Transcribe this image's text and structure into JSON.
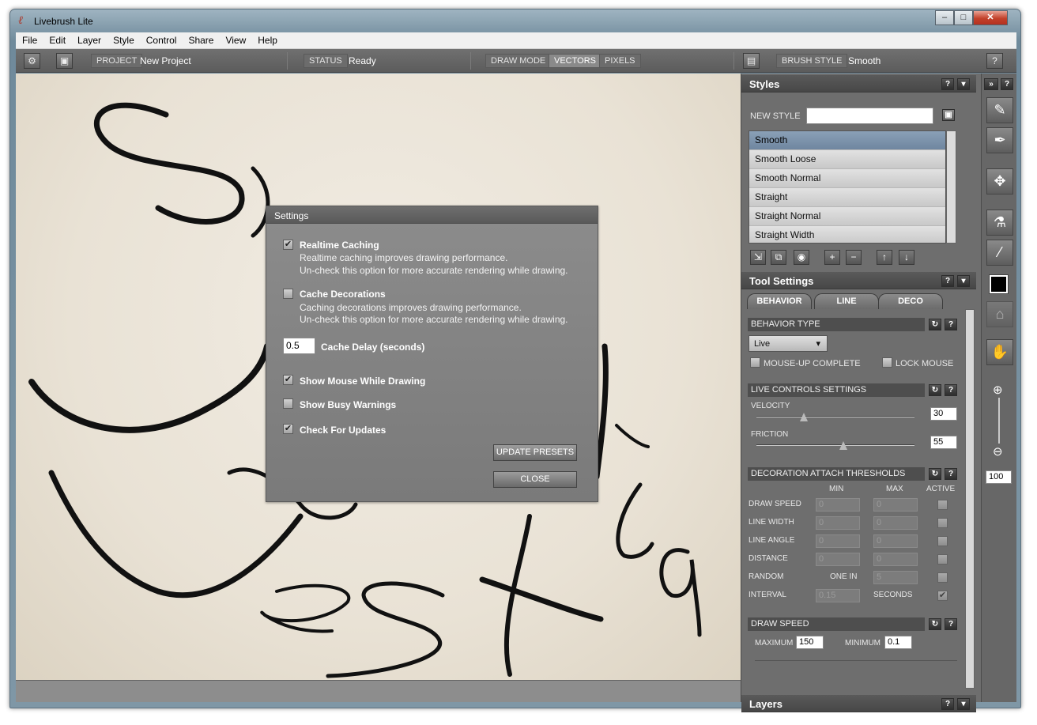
{
  "window": {
    "title": "Livebrush Lite",
    "minimize": "–",
    "maximize": "□",
    "close": "✕"
  },
  "menu": [
    "File",
    "Edit",
    "Layer",
    "Style",
    "Control",
    "Share",
    "View",
    "Help"
  ],
  "toolbar": {
    "project_label": "PROJECT",
    "project_value": "New Project",
    "status_label": "STATUS",
    "status_value": "Ready",
    "draw_mode_label": "DRAW MODE",
    "vectors": "VECTORS",
    "pixels": "PIXELS",
    "brush_style_label": "BRUSH STYLE",
    "brush_style_value": "Smooth",
    "help": "?"
  },
  "canvas_handwriting": "Softpedia",
  "settings_dialog": {
    "title": "Settings",
    "realtime_caching": {
      "label": "Realtime Caching",
      "checked": true,
      "desc1": "Realtime caching improves drawing performance.",
      "desc2": "Un-check this option for more accurate rendering while drawing."
    },
    "cache_decorations": {
      "label": "Cache Decorations",
      "checked": false,
      "desc1": "Caching decorations improves drawing performance.",
      "desc2": "Un-check this option for more accurate rendering while drawing."
    },
    "cache_delay_value": "0.5",
    "cache_delay_label": "Cache Delay (seconds)",
    "show_mouse": {
      "label": "Show Mouse While Drawing",
      "checked": true
    },
    "show_busy": {
      "label": "Show Busy Warnings",
      "checked": false
    },
    "check_updates": {
      "label": "Check For Updates",
      "checked": true
    },
    "update_presets": "UPDATE PRESETS",
    "close": "CLOSE"
  },
  "styles_panel": {
    "title": "Styles",
    "new_style_label": "NEW STYLE",
    "new_style_value": "",
    "items": [
      "Smooth",
      "Smooth Loose",
      "Smooth Normal",
      "Straight",
      "Straight Normal",
      "Straight Width"
    ],
    "selected": 0
  },
  "tool_settings": {
    "title": "Tool Settings",
    "tabs": [
      "BEHAVIOR",
      "LINE",
      "DECO"
    ],
    "behavior_type_header": "BEHAVIOR TYPE",
    "behavior_type_value": "Live",
    "mouse_up_complete": "MOUSE-UP COMPLETE",
    "lock_mouse": "LOCK MOUSE",
    "live_controls_header": "LIVE CONTROLS SETTINGS",
    "velocity_label": "VELOCITY",
    "velocity_value": "30",
    "velocity_level": 0.3,
    "friction_label": "FRICTION",
    "friction_value": "55",
    "friction_level": 0.55,
    "deco_header": "DECORATION ATTACH THRESHOLDS",
    "col_min": "MIN",
    "col_max": "MAX",
    "col_active": "ACTIVE",
    "rows": [
      {
        "label": "DRAW SPEED",
        "min": "0",
        "max": "0"
      },
      {
        "label": "LINE WIDTH",
        "min": "0",
        "max": "0"
      },
      {
        "label": "LINE ANGLE",
        "min": "0",
        "max": "0"
      },
      {
        "label": "DISTANCE",
        "min": "0",
        "max": "0"
      }
    ],
    "random_label": "RANDOM",
    "random_mid": "ONE IN",
    "random_value": "5",
    "interval_label": "INTERVAL",
    "interval_value": "0.15",
    "interval_unit": "SECONDS",
    "draw_speed_header": "DRAW SPEED",
    "maximum_label": "MAXIMUM",
    "maximum_value": "150",
    "minimum_label": "MINIMUM",
    "minimum_value": "0.1"
  },
  "layers_panel": {
    "title": "Layers"
  },
  "zoom_value": "100"
}
